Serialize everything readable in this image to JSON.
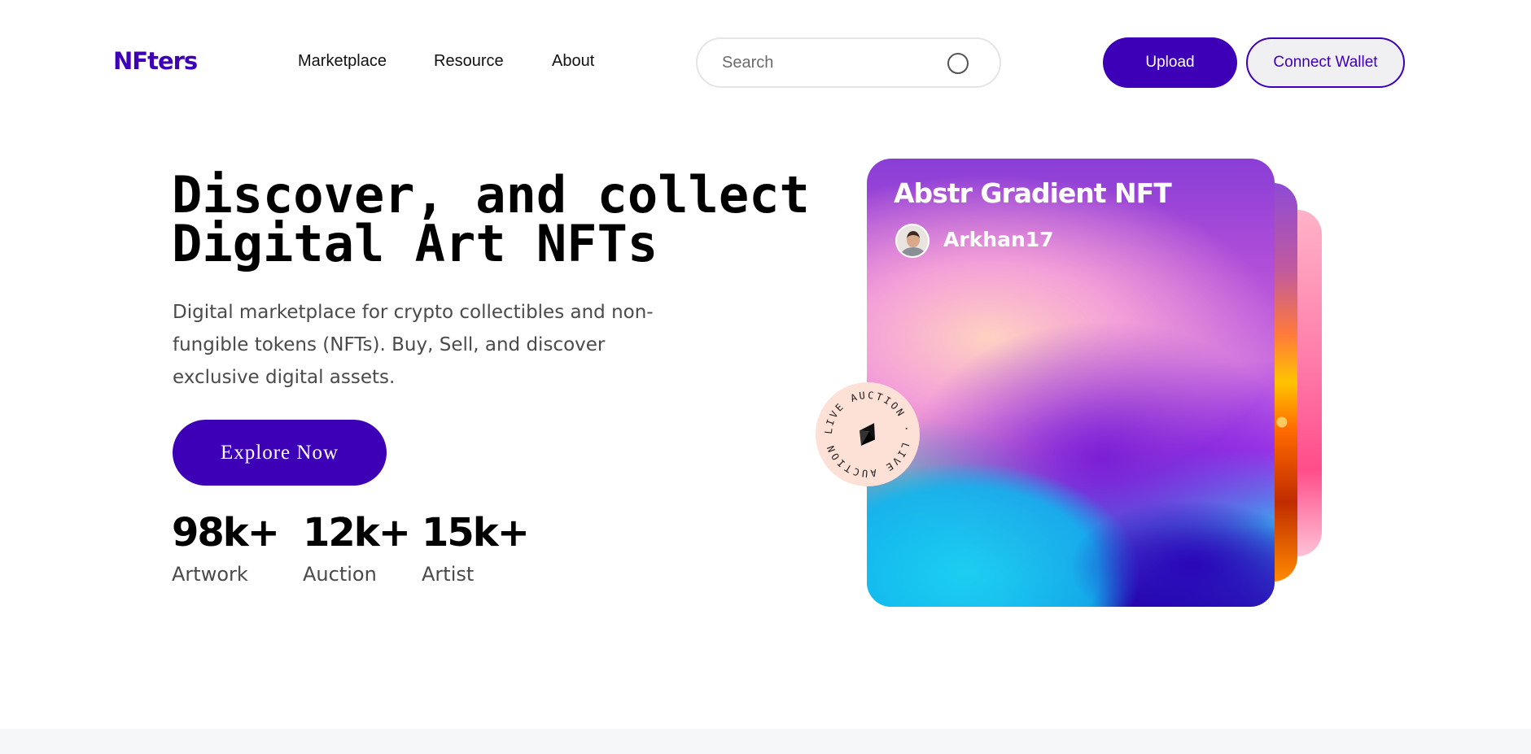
{
  "header": {
    "logo": "NFters",
    "nav": [
      "Marketplace",
      "Resource",
      "About"
    ],
    "search_placeholder": "Search",
    "upload_label": "Upload",
    "connect_wallet_label": "Connect Wallet"
  },
  "hero": {
    "title_line1": "Discover, and collect",
    "title_line2": "Digital Art NFTs",
    "description": "Digital marketplace for crypto collectibles and non-fungible tokens (NFTs). Buy, Sell, and discover exclusive digital assets.",
    "cta_label": "Explore Now",
    "stats": [
      {
        "value": "98k+",
        "label": "Artwork"
      },
      {
        "value": "12k+",
        "label": "Auction"
      },
      {
        "value": "15k+",
        "label": "Artist"
      }
    ]
  },
  "nft_card": {
    "title": "Abstr Gradient NFT",
    "artist": "Arkhan17",
    "badge_text": "LIVE AUCTION · LIVE AUCTION ·",
    "badge_icon": "ethereum-icon"
  },
  "colors": {
    "brand": "#3D00B7",
    "badge_bg": "#FDE0D6"
  }
}
